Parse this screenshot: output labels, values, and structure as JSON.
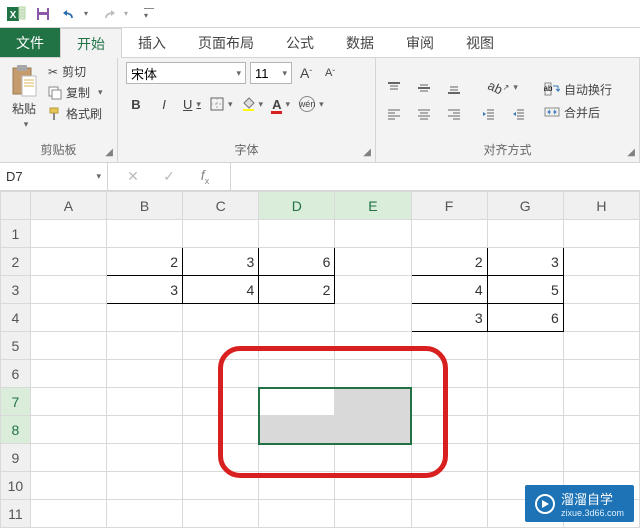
{
  "tabs": {
    "file": "文件",
    "home": "开始",
    "insert": "插入",
    "layout": "页面布局",
    "formulas": "公式",
    "data": "数据",
    "review": "审阅",
    "view": "视图"
  },
  "clipboard": {
    "paste": "粘贴",
    "cut": "剪切",
    "copy": "复制",
    "format_painter": "格式刷",
    "group_label": "剪贴板"
  },
  "font": {
    "name": "宋体",
    "size": "11",
    "bold": "B",
    "italic": "I",
    "underline": "U",
    "group_label": "字体"
  },
  "align": {
    "wrap": "自动换行",
    "merge": "合并后",
    "group_label": "对齐方式"
  },
  "namebox": "D7",
  "chart_data": {
    "type": "table",
    "tables": [
      {
        "range": "B2:D3",
        "columns": [
          "B",
          "C",
          "D"
        ],
        "rows": [
          {
            "B": 2,
            "C": 3,
            "D": 6
          },
          {
            "B": 3,
            "C": 4,
            "D": 2
          }
        ]
      },
      {
        "range": "F2:G4",
        "columns": [
          "F",
          "G"
        ],
        "rows": [
          {
            "F": 2,
            "G": 3
          },
          {
            "F": 4,
            "G": 5
          },
          {
            "F": 3,
            "G": 6
          }
        ]
      }
    ],
    "selection": "D7:E8",
    "active_cell": "D7"
  },
  "columns": [
    "A",
    "B",
    "C",
    "D",
    "E",
    "F",
    "G",
    "H"
  ],
  "rows": [
    "1",
    "2",
    "3",
    "4",
    "5",
    "6",
    "7",
    "8",
    "9",
    "10",
    "11"
  ],
  "watermark": {
    "title": "溜溜自学",
    "sub": "zixue.3d66.com"
  }
}
